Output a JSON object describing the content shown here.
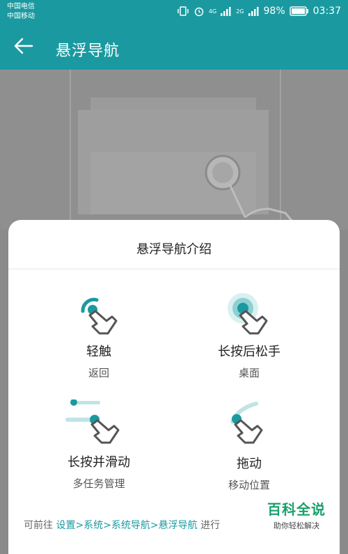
{
  "status": {
    "carrier1": "中国电信",
    "carrier2": "中国移动",
    "network_4g": "4G",
    "network_2g": "2G",
    "battery": "98%",
    "time": "03:37"
  },
  "appbar": {
    "title": "悬浮导航"
  },
  "sheet": {
    "title": "悬浮导航介绍",
    "gestures": [
      {
        "title": "轻触",
        "sub": "返回"
      },
      {
        "title": "长按后松手",
        "sub": "桌面"
      },
      {
        "title": "长按并滑动",
        "sub": "多任务管理"
      },
      {
        "title": "拖动",
        "sub": "移动位置"
      }
    ],
    "footer": {
      "prefix": "可前往 ",
      "link": "设置>系统>系统导航>悬浮导航",
      "suffix": " 进行"
    }
  },
  "watermark": {
    "brand": "百科全说",
    "slogan": "助你轻松解决"
  },
  "colors": {
    "accent": "#1a9aa0",
    "brand_green": "#1aa06b"
  }
}
